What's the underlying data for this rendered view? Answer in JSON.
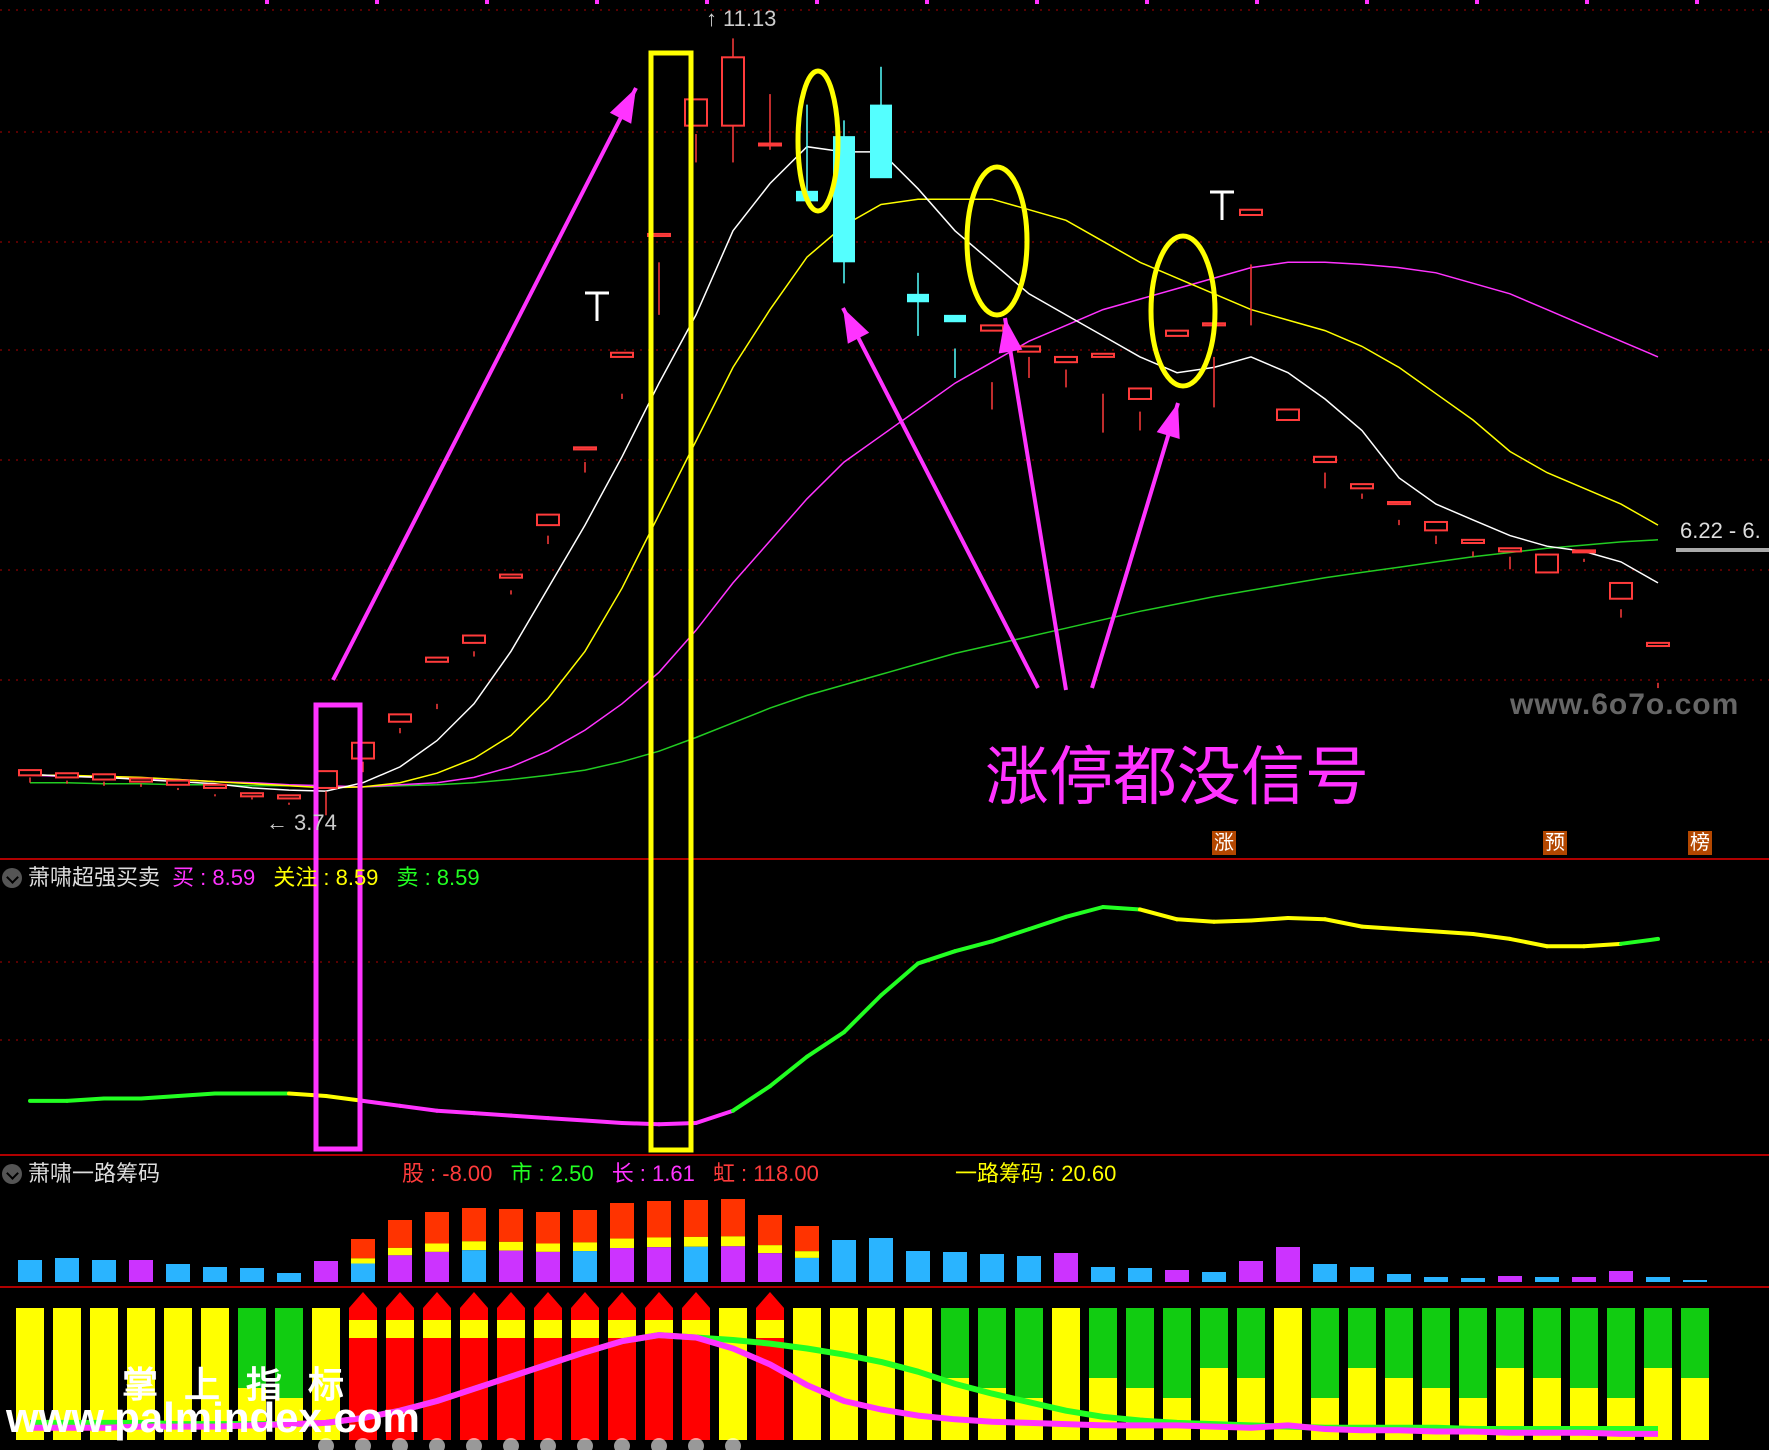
{
  "colors": {
    "up": "#ff3b3b",
    "down": "#54ffff",
    "ma5": "#ffffff",
    "ma10": "#ffff00",
    "ma20": "#ff33ff",
    "ma60": "#22cc22",
    "grid": "#b00000",
    "highlight_yellow": "#ffff00",
    "highlight_magenta": "#ff33ff"
  },
  "price_panel": {
    "high_label": "11.13",
    "low_label": "3.74",
    "last_label": "6.22 - 6.",
    "tags": [
      "涨",
      "预",
      "榜"
    ],
    "annotation": "涨停都没信号",
    "watermark": "www.6o7o.com"
  },
  "panel1": {
    "name": "萧啸超强买卖",
    "items": [
      {
        "label": "买",
        "value": "8.59",
        "color": "#ff33ff"
      },
      {
        "label": "关注",
        "value": "8.59",
        "color": "#ffff00"
      },
      {
        "label": "卖",
        "value": "8.59",
        "color": "#22ff22"
      }
    ]
  },
  "panel2": {
    "name": "萧啸一路筹码",
    "items": [
      {
        "label": "股",
        "value": "-8.00",
        "color": "#ff3b3b"
      },
      {
        "label": "市",
        "value": "2.50",
        "color": "#22ff22"
      },
      {
        "label": "长",
        "value": "1.61",
        "color": "#ff33ff"
      },
      {
        "label": "虹",
        "value": "118.00",
        "color": "#ff3b3b"
      },
      {
        "label": "一路筹码",
        "value": "20.60",
        "color": "#ffff00"
      }
    ]
  },
  "watermark2": {
    "cn": "掌 上 指 标",
    "url": "www.palmindex.com"
  },
  "chart_data": [
    {
      "type": "candlestick",
      "candles": [
        [
          4.12,
          4.17,
          4.1,
          4.05
        ],
        [
          4.1,
          4.14,
          4.07,
          4.04
        ],
        [
          4.08,
          4.13,
          4.06,
          4.02
        ],
        [
          4.06,
          4.09,
          4.04,
          4.01
        ],
        [
          4.03,
          4.07,
          4.0,
          3.98
        ],
        [
          4.0,
          4.03,
          3.94,
          3.92
        ],
        [
          3.92,
          3.95,
          3.91,
          3.89
        ],
        [
          3.9,
          3.93,
          3.86,
          3.84
        ],
        [
          4.0,
          4.16,
          3.97,
          3.74
        ],
        [
          4.28,
          4.43,
          4.25,
          4.15
        ],
        [
          4.63,
          4.7,
          4.57,
          4.52
        ],
        [
          5.2,
          5.24,
          4.8,
          4.75
        ],
        [
          5.38,
          5.45,
          5.3,
          5.25
        ],
        [
          6.0,
          6.03,
          5.88,
          5.84
        ],
        [
          6.5,
          6.6,
          6.4,
          6.32
        ],
        [
          7.22,
          7.24,
          7.1,
          7.0
        ],
        [
          8.1,
          8.14,
          7.75,
          7.7
        ],
        [
          9.25,
          9.27,
          9.0,
          8.5
        ],
        [
          10.3,
          10.55,
          10.22,
          9.95
        ],
        [
          10.3,
          10.95,
          11.13,
          9.95
        ],
        [
          10.12,
          10.13,
          10.07,
          10.6
        ],
        [
          9.68,
          9.58,
          9.6,
          10.5
        ],
        [
          10.2,
          9.0,
          10.35,
          8.8
        ],
        [
          10.5,
          9.8,
          10.86,
          10.1
        ],
        [
          8.7,
          8.62,
          8.9,
          8.3
        ],
        [
          8.5,
          8.43,
          8.18,
          7.9
        ],
        [
          8.35,
          8.4,
          7.86,
          7.6
        ],
        [
          8.15,
          8.2,
          8.1,
          7.9
        ],
        [
          8.05,
          8.1,
          7.98,
          7.81
        ],
        [
          8.1,
          8.13,
          7.75,
          7.38
        ],
        [
          7.7,
          7.8,
          7.58,
          7.4
        ],
        [
          8.3,
          8.35,
          7.65,
          7.6
        ],
        [
          8.4,
          8.42,
          8.1,
          7.62
        ],
        [
          9.45,
          9.5,
          8.98,
          8.4
        ],
        [
          7.5,
          7.6,
          7.25,
          7.25
        ],
        [
          7.1,
          7.15,
          7.0,
          6.85
        ],
        [
          6.85,
          6.89,
          6.8,
          6.75
        ],
        [
          6.7,
          6.72,
          6.55,
          6.5
        ],
        [
          6.45,
          6.53,
          6.4,
          6.32
        ],
        [
          6.33,
          6.36,
          6.25,
          6.2
        ],
        [
          6.25,
          6.28,
          6.2,
          6.08
        ],
        [
          6.05,
          6.22,
          6.06,
          6.1
        ],
        [
          6.25,
          6.26,
          6.18,
          6.15
        ],
        [
          5.8,
          5.95,
          5.7,
          5.62
        ],
        [
          5.35,
          5.38,
          5.0,
          4.95
        ]
      ],
      "ma5": [
        4.13,
        4.11,
        4.1,
        4.08,
        4.06,
        4.04,
        4.0,
        3.98,
        3.97,
        4.05,
        4.2,
        4.45,
        4.8,
        5.3,
        5.9,
        6.5,
        7.15,
        7.85,
        8.5,
        9.3,
        9.75,
        10.1,
        10.05,
        10.05,
        9.7,
        9.3,
        9.0,
        8.7,
        8.5,
        8.3,
        8.1,
        7.95,
        8.0,
        8.1,
        7.95,
        7.7,
        7.4,
        6.95,
        6.7,
        6.55,
        6.4,
        6.3,
        6.25,
        6.15,
        5.95
      ],
      "ma10": [
        4.12,
        4.12,
        4.11,
        4.1,
        4.08,
        4.06,
        4.04,
        4.02,
        4.0,
        4.01,
        4.05,
        4.14,
        4.28,
        4.5,
        4.85,
        5.3,
        5.9,
        6.6,
        7.3,
        8.0,
        8.55,
        9.05,
        9.35,
        9.55,
        9.6,
        9.6,
        9.6,
        9.5,
        9.4,
        9.2,
        9.0,
        8.85,
        8.7,
        8.55,
        8.45,
        8.35,
        8.2,
        8.0,
        7.75,
        7.5,
        7.2,
        7.0,
        6.85,
        6.7,
        6.5
      ],
      "ma20": [
        4.12,
        4.11,
        4.1,
        4.09,
        4.08,
        4.06,
        4.05,
        4.03,
        4.02,
        4.01,
        4.03,
        4.05,
        4.1,
        4.2,
        4.35,
        4.55,
        4.8,
        5.1,
        5.5,
        5.95,
        6.35,
        6.75,
        7.1,
        7.35,
        7.6,
        7.85,
        8.05,
        8.25,
        8.4,
        8.55,
        8.65,
        8.75,
        8.85,
        8.95,
        9.0,
        9.0,
        8.98,
        8.95,
        8.9,
        8.8,
        8.7,
        8.55,
        8.4,
        8.25,
        8.1
      ],
      "ma60": [
        4.05,
        4.05,
        4.04,
        4.04,
        4.03,
        4.03,
        4.02,
        4.02,
        4.01,
        4.01,
        4.02,
        4.03,
        4.05,
        4.08,
        4.12,
        4.17,
        4.25,
        4.35,
        4.48,
        4.62,
        4.76,
        4.88,
        4.98,
        5.08,
        5.18,
        5.28,
        5.36,
        5.44,
        5.52,
        5.6,
        5.68,
        5.75,
        5.82,
        5.88,
        5.94,
        6.0,
        6.05,
        6.1,
        6.15,
        6.2,
        6.24,
        6.28,
        6.31,
        6.34,
        6.36
      ],
      "ylim": [
        3.6,
        11.4
      ]
    },
    {
      "type": "line",
      "name": "萧啸超强买卖",
      "values": [
        2.0,
        2.0,
        2.1,
        2.1,
        2.2,
        2.3,
        2.3,
        2.3,
        2.2,
        2.0,
        1.8,
        1.6,
        1.5,
        1.4,
        1.3,
        1.2,
        1.1,
        1.05,
        1.1,
        1.6,
        2.6,
        3.8,
        4.8,
        6.3,
        7.6,
        8.1,
        8.5,
        9.0,
        9.5,
        9.9,
        9.8,
        9.4,
        9.3,
        9.35,
        9.45,
        9.4,
        9.1,
        9.0,
        8.9,
        8.8,
        8.6,
        8.3,
        8.3,
        8.4,
        8.6
      ],
      "state": [
        "g",
        "g",
        "g",
        "g",
        "g",
        "g",
        "g",
        "y",
        "y",
        "m",
        "m",
        "m",
        "m",
        "m",
        "m",
        "m",
        "m",
        "m",
        "m",
        "g",
        "g",
        "g",
        "g",
        "g",
        "g",
        "g",
        "g",
        "g",
        "g",
        "g",
        "y",
        "y",
        "y",
        "y",
        "y",
        "y",
        "y",
        "y",
        "y",
        "y",
        "y",
        "y",
        "y",
        "g",
        "g"
      ],
      "ylim": [
        0,
        11
      ]
    },
    {
      "type": "bar",
      "name": "萧啸一路筹码",
      "top_bars": [
        22,
        24,
        22,
        22,
        18,
        15,
        14,
        9,
        21,
        43,
        62,
        70,
        74,
        73,
        70,
        72,
        79,
        81,
        82,
        83,
        67,
        56,
        42,
        44,
        31,
        30,
        28,
        26,
        29,
        15,
        14,
        12,
        10,
        21,
        35,
        18,
        15,
        8,
        5,
        4,
        6,
        5,
        5,
        11,
        5,
        2
      ],
      "top_colors": [
        "c",
        "c",
        "c",
        "m",
        "c",
        "c",
        "c",
        "c",
        "m",
        "red",
        "red",
        "red",
        "red",
        "red",
        "red",
        "red",
        "red",
        "red",
        "red",
        "red",
        "red",
        "red",
        "c",
        "c",
        "c",
        "c",
        "c",
        "c",
        "m",
        "c",
        "c",
        "m",
        "c",
        "m",
        "m",
        "c",
        "c",
        "c",
        "c",
        "c",
        "m",
        "c",
        "m",
        "m",
        "c",
        "c"
      ],
      "bottom_colors": [
        "y",
        "y",
        "y",
        "y",
        "y",
        "y",
        "g",
        "g",
        "y",
        "r",
        "r",
        "r",
        "r",
        "r",
        "r",
        "r",
        "r",
        "r",
        "r",
        "y",
        "r",
        "y",
        "y",
        "y",
        "y",
        "g",
        "g",
        "g",
        "y",
        "g",
        "g",
        "g",
        "g",
        "g",
        "y",
        "g",
        "g",
        "g",
        "g",
        "g",
        "g",
        "g",
        "g",
        "g",
        "g",
        "g"
      ],
      "line_magenta": [
        0.1,
        0.1,
        0.1,
        0.11,
        0.11,
        0.11,
        0.12,
        0.13,
        0.14,
        0.18,
        0.24,
        0.32,
        0.42,
        0.52,
        0.62,
        0.72,
        0.81,
        0.86,
        0.84,
        0.75,
        0.62,
        0.45,
        0.32,
        0.25,
        0.2,
        0.17,
        0.15,
        0.14,
        0.13,
        0.12,
        0.12,
        0.12,
        0.11,
        0.1,
        0.12,
        0.09,
        0.08,
        0.08,
        0.07,
        0.07,
        0.06,
        0.06,
        0.06,
        0.05,
        0.05
      ],
      "line_green": [
        0.14,
        0.14,
        0.14,
        0.14,
        0.13,
        0.13,
        0.13,
        0.13,
        0.14,
        0.18,
        0.24,
        0.32,
        0.42,
        0.52,
        0.62,
        0.72,
        0.81,
        0.86,
        0.84,
        0.82,
        0.79,
        0.75,
        0.7,
        0.64,
        0.56,
        0.46,
        0.38,
        0.31,
        0.24,
        0.19,
        0.16,
        0.14,
        0.13,
        0.12,
        0.11,
        0.1,
        0.1,
        0.1,
        0.1,
        0.09,
        0.09,
        0.09,
        0.09,
        0.09,
        0.09
      ],
      "ylim": [
        0,
        1
      ]
    }
  ]
}
